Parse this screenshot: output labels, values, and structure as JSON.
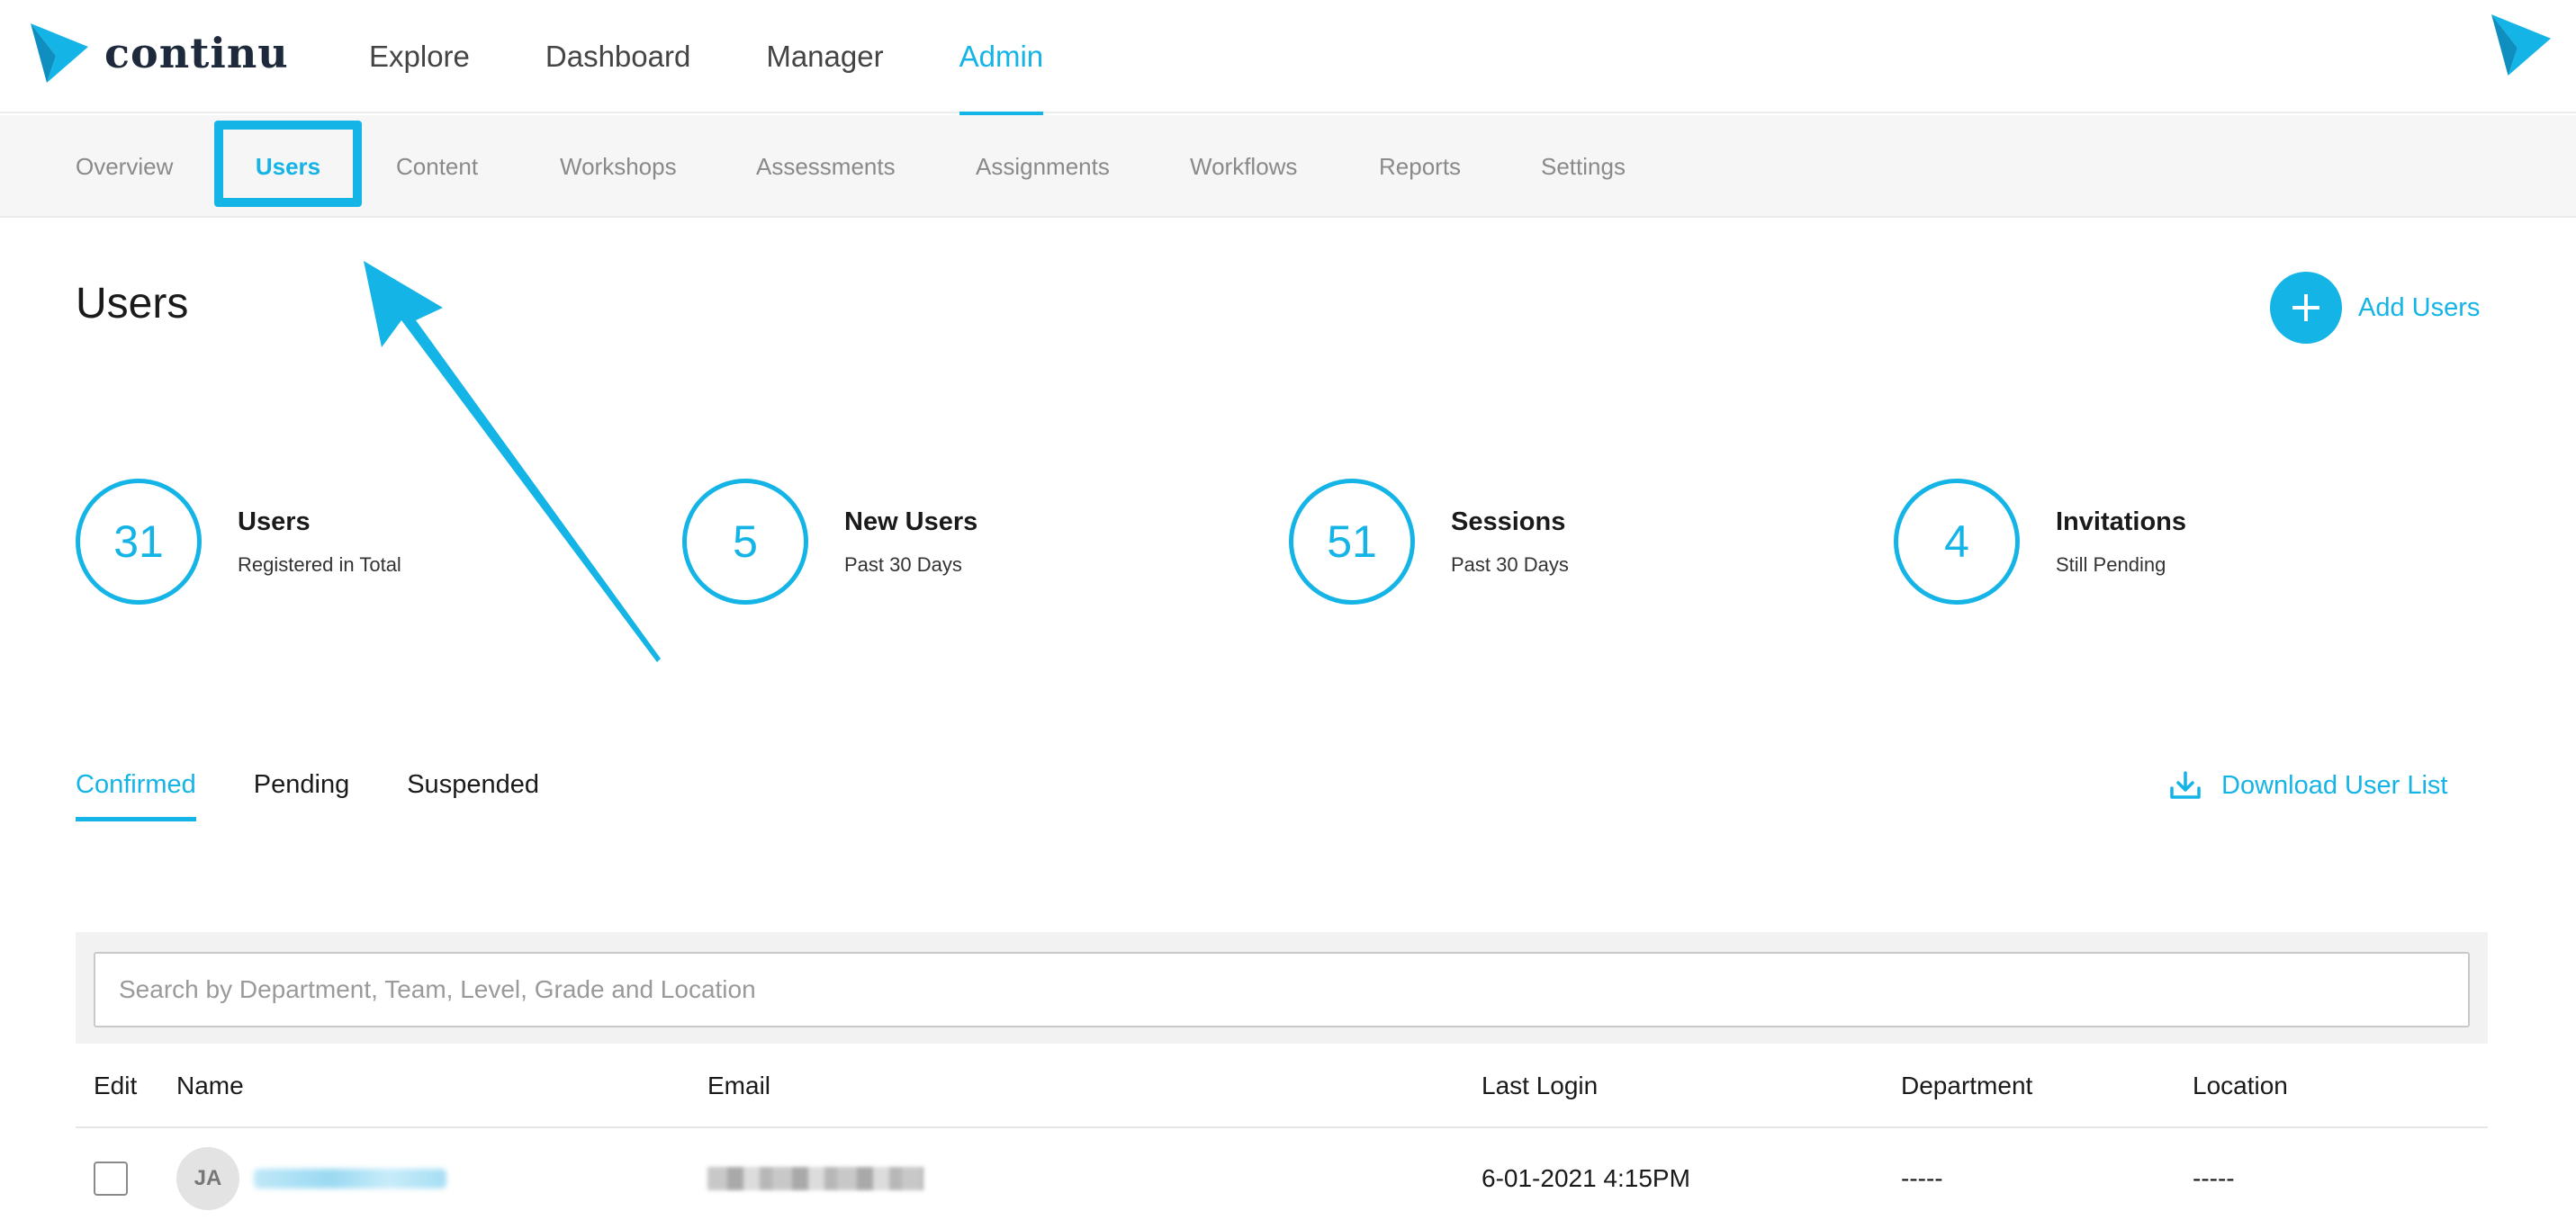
{
  "brand": {
    "name": "continu",
    "color": "#14b4e6",
    "logo_icon": "paper-plane-logo-icon"
  },
  "main_nav": [
    {
      "label": "Explore",
      "active": false
    },
    {
      "label": "Dashboard",
      "active": false
    },
    {
      "label": "Manager",
      "active": false
    },
    {
      "label": "Admin",
      "active": true
    }
  ],
  "sub_nav": [
    {
      "label": "Overview",
      "active": false
    },
    {
      "label": "Users",
      "active": true
    },
    {
      "label": "Content",
      "active": false
    },
    {
      "label": "Workshops",
      "active": false
    },
    {
      "label": "Assessments",
      "active": false
    },
    {
      "label": "Assignments",
      "active": false
    },
    {
      "label": "Workflows",
      "active": false
    },
    {
      "label": "Reports",
      "active": false
    },
    {
      "label": "Settings",
      "active": false
    }
  ],
  "page": {
    "title": "Users",
    "add_button_label": "Add Users",
    "add_icon": "plus-icon"
  },
  "stats": [
    {
      "value": "31",
      "title": "Users",
      "subtitle": "Registered in Total"
    },
    {
      "value": "5",
      "title": "New Users",
      "subtitle": "Past 30 Days"
    },
    {
      "value": "51",
      "title": "Sessions",
      "subtitle": "Past 30 Days"
    },
    {
      "value": "4",
      "title": "Invitations",
      "subtitle": "Still Pending"
    }
  ],
  "tabs": [
    {
      "label": "Confirmed",
      "active": true
    },
    {
      "label": "Pending",
      "active": false
    },
    {
      "label": "Suspended",
      "active": false
    }
  ],
  "download": {
    "label": "Download User List",
    "icon": "download-icon"
  },
  "search": {
    "placeholder": "Search by Department, Team, Level, Grade and Location",
    "value": ""
  },
  "table": {
    "columns": [
      "Edit",
      "Name",
      "Email",
      "Last Login",
      "Department",
      "Location"
    ],
    "rows": [
      {
        "initials": "JA",
        "last_login": "6-01-2021 4:15PM",
        "department": "-----",
        "location": "-----",
        "checked": false
      }
    ]
  },
  "annotation": {
    "type": "highlight-arrow",
    "color": "#14b4e6"
  }
}
